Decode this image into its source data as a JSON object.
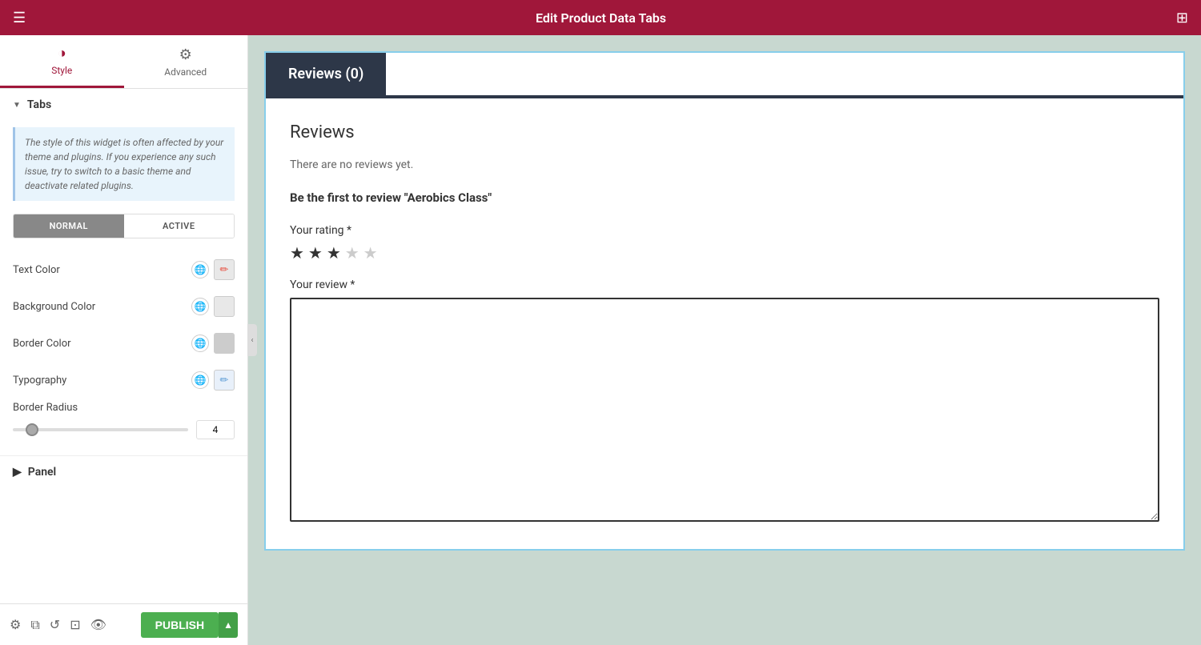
{
  "topBar": {
    "title": "Edit Product Data Tabs",
    "hamburgerIcon": "☰",
    "gridIcon": "⊞"
  },
  "leftPanel": {
    "tabs": [
      {
        "id": "style",
        "label": "Style",
        "icon": "◑",
        "active": true
      },
      {
        "id": "advanced",
        "label": "Advanced",
        "icon": "⚙",
        "active": false
      }
    ],
    "sections": {
      "tabs": {
        "label": "Tabs",
        "infoText": "The style of this widget is often affected by your theme and plugins. If you experience any such issue, try to switch to a basic theme and deactivate related plugins.",
        "normalLabel": "NORMAL",
        "activeLabel": "ACTIVE",
        "properties": [
          {
            "id": "text-color",
            "label": "Text Color"
          },
          {
            "id": "background-color",
            "label": "Background Color"
          },
          {
            "id": "border-color",
            "label": "Border Color"
          },
          {
            "id": "typography",
            "label": "Typography"
          }
        ],
        "borderRadius": {
          "label": "Border Radius",
          "value": 4,
          "min": 0,
          "max": 50
        }
      },
      "panel": {
        "label": "Panel"
      }
    }
  },
  "bottomToolbar": {
    "publishLabel": "PUBLISH",
    "icons": [
      "settings-icon",
      "layers-icon",
      "history-icon",
      "responsive-icon",
      "eye-icon"
    ]
  },
  "canvas": {
    "reviewsTab": {
      "label": "Reviews (0)"
    },
    "reviewsContent": {
      "title": "Reviews",
      "noReviews": "There are no reviews yet.",
      "firstReview": "Be the first to review \"Aerobics Class\"",
      "ratingLabel": "Your rating *",
      "stars": [
        true,
        true,
        true,
        false,
        false
      ],
      "reviewLabel": "Your review *"
    }
  },
  "colors": {
    "accent": "#a0173a",
    "activeTabBg": "#2d3748",
    "activeTabText": "#ffffff"
  }
}
